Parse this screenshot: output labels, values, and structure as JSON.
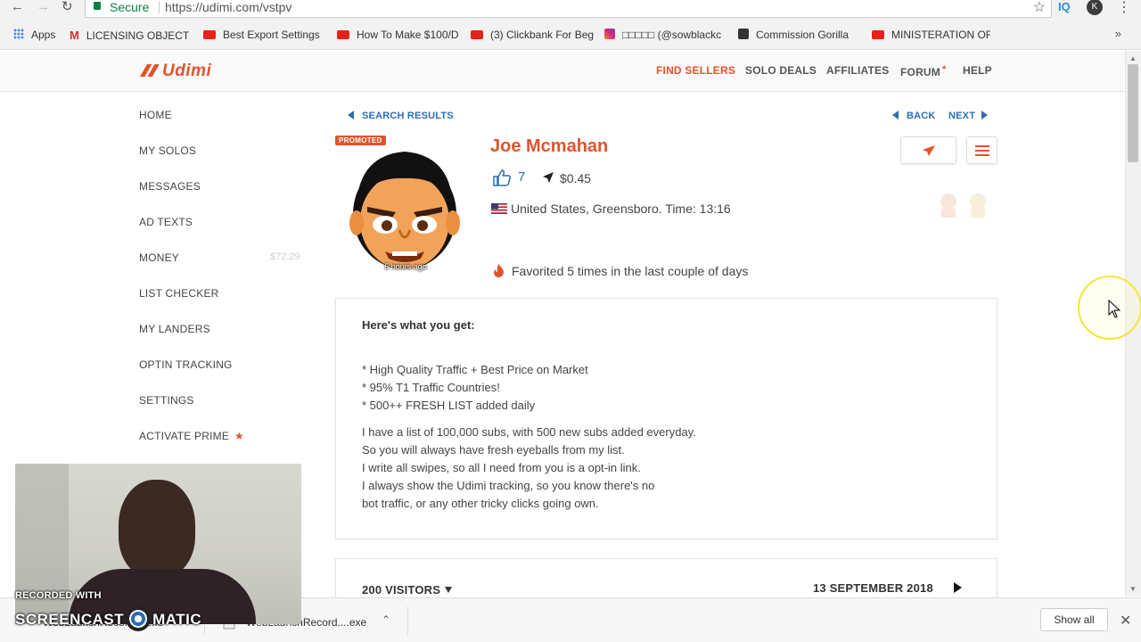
{
  "browser": {
    "secure_label": "Secure",
    "url": "https://udimi.com/vstpv",
    "extension_label": "IQ",
    "profile_initial": "K",
    "bookmarks": [
      {
        "label": "Apps"
      },
      {
        "label": "LICENSING OBJECTIV"
      },
      {
        "label": "Best Export Settings"
      },
      {
        "label": "How To Make $100/D"
      },
      {
        "label": "(3) Clickbank For Beg"
      },
      {
        "label": "□□□□□ (@sowblackc"
      },
      {
        "label": "Commission Gorilla"
      },
      {
        "label": "MINISTERATION OF"
      }
    ],
    "more_label": "»"
  },
  "site": {
    "brand": "Udimi",
    "nav": [
      {
        "label": "FIND SELLERS"
      },
      {
        "label": "SOLO DEALS"
      },
      {
        "label": "AFFILIATES"
      },
      {
        "label": "FORUM"
      },
      {
        "label": "HELP"
      }
    ],
    "forum_marker": "*"
  },
  "sidebar": {
    "items": [
      {
        "label": "HOME"
      },
      {
        "label": "MY SOLOS"
      },
      {
        "label": "MESSAGES"
      },
      {
        "label": "AD TEXTS"
      },
      {
        "label": "MONEY"
      },
      {
        "label": "LIST CHECKER"
      },
      {
        "label": "MY LANDERS"
      },
      {
        "label": "OPTIN TRACKING"
      },
      {
        "label": "SETTINGS"
      },
      {
        "label": "ACTIVATE PRIME"
      }
    ],
    "money_value": "$72.29",
    "prime_marker": "★"
  },
  "profile": {
    "search_results_label": "SEARCH RESULTS",
    "back_label": "BACK",
    "next_label": "NEXT",
    "promoted_badge": "PROMOTED",
    "last_seen": "5 hours ago",
    "name": "Joe Mcmahan",
    "likes": "7",
    "price": "$0.45",
    "location": "United States, Greensboro. Time: 13:16",
    "favorited": "Favorited 5 times in the last couple of days"
  },
  "description": {
    "heading": "Here's what you get:",
    "bullets": [
      "* High Quality Traffic + Best Price on Market",
      "* 95% T1 Traffic Countries!",
      "* 500++ FRESH LIST added daily"
    ],
    "paragraph": [
      "I have a list of 100,000 subs, with 500 new subs added everyday.",
      "So you will always have fresh eyeballs from my list.",
      "I write all swipes, so all I need from you is a opt-in link.",
      "I always show the Udimi tracking, so you know there's no",
      "bot traffic, or any other tricky clicks going own."
    ]
  },
  "stats": {
    "visitors_label": "200 VISITORS",
    "date_label": "13 SEPTEMBER 2018"
  },
  "recording": {
    "recorded_with": "RECORDED WITH",
    "brand_left": "SCREENCAST",
    "brand_right": "MATIC"
  },
  "downloads": {
    "items": [
      {
        "label": "WebLaunchRecord....exe"
      },
      {
        "label": "WebLaunchRecord....exe"
      }
    ],
    "show_all_label": "Show all"
  },
  "colors": {
    "brand": "#e0542a",
    "link": "#2a6db5",
    "secure": "#0b8043"
  }
}
